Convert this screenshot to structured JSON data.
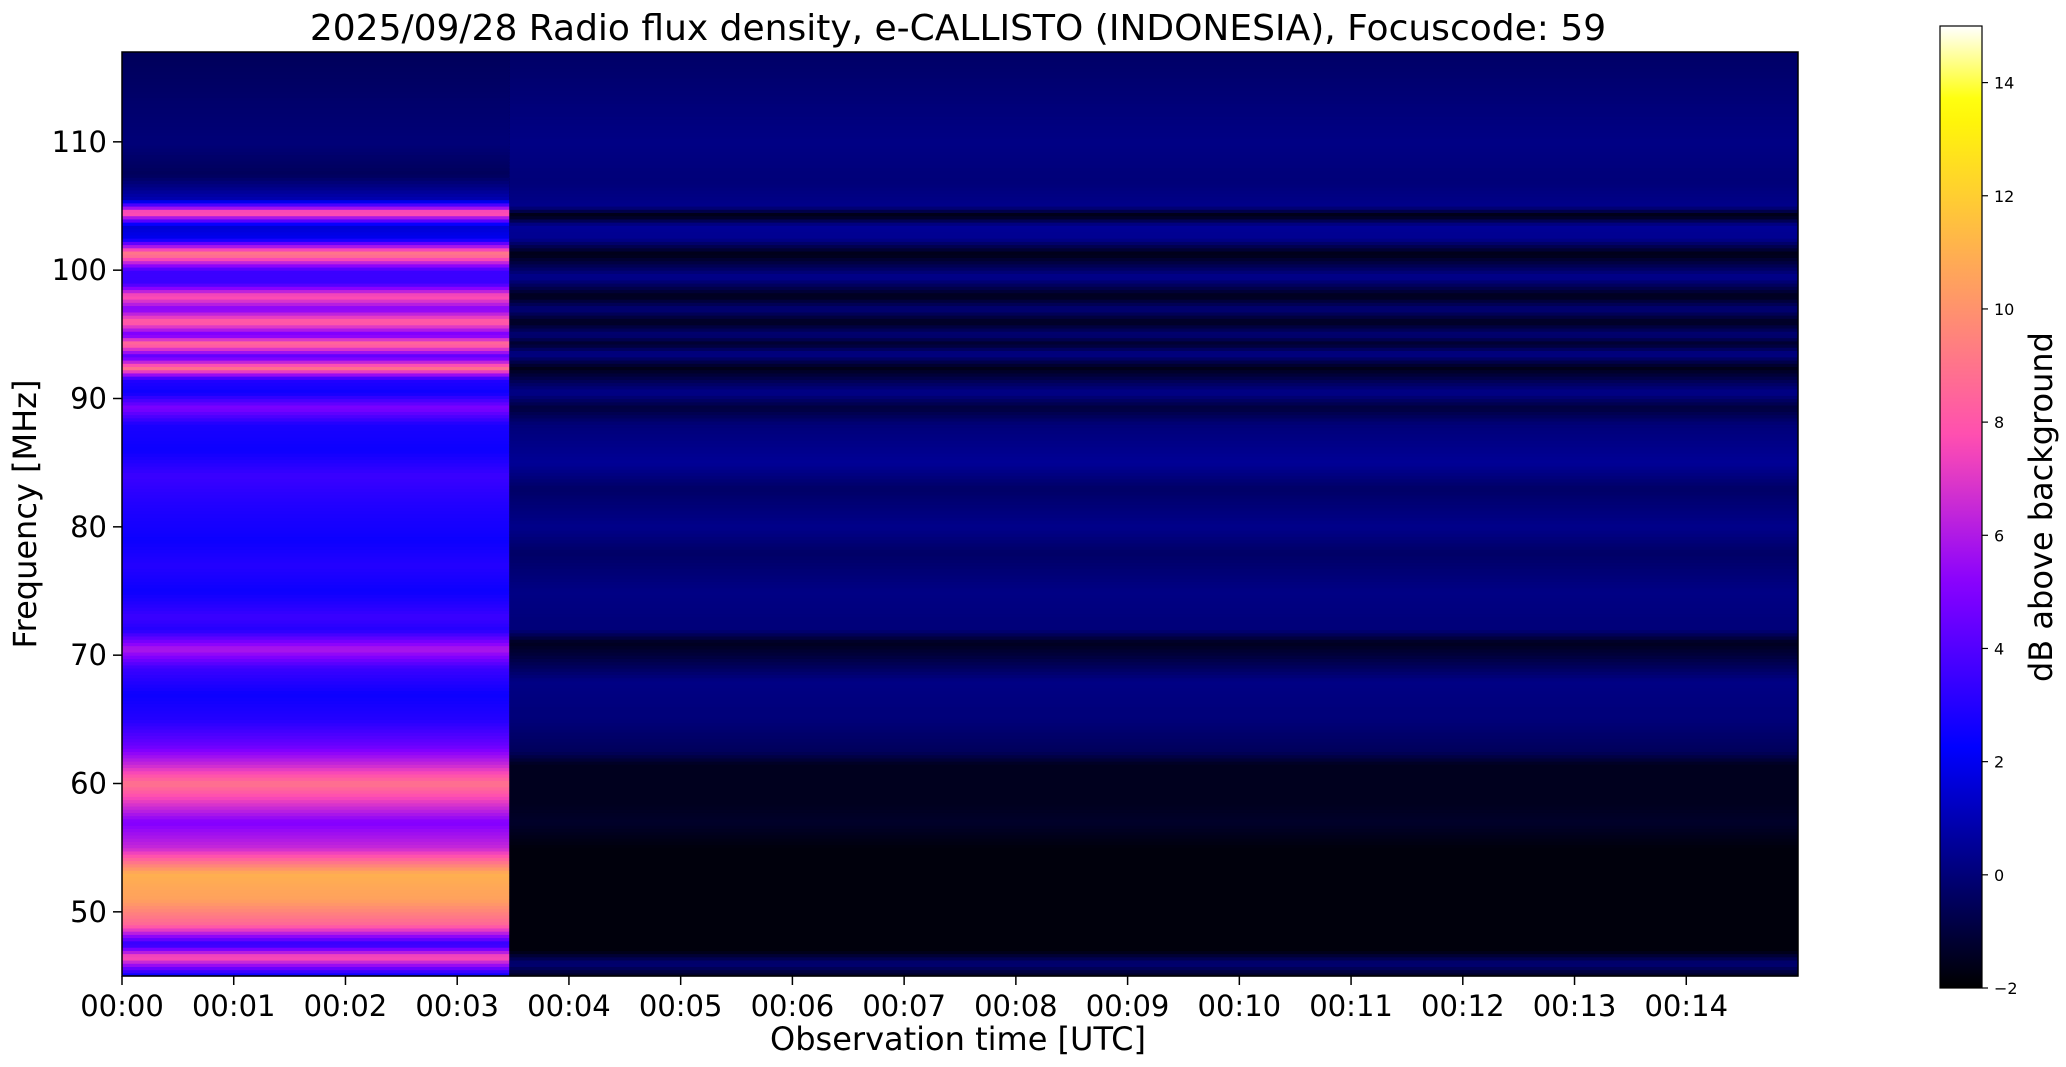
{
  "chart_data": {
    "type": "heatmap",
    "title": "2025/09/28  Radio flux density, e-CALLISTO (INDONESIA), Focuscode: 59",
    "xlabel": "Observation time [UTC]",
    "ylabel": "Frequency [MHz]",
    "xlim": [
      "00:00",
      "00:15"
    ],
    "ylim": [
      45,
      117
    ],
    "x_ticks": [
      "00:00",
      "00:01",
      "00:02",
      "00:03",
      "00:04",
      "00:05",
      "00:06",
      "00:07",
      "00:08",
      "00:09",
      "00:10",
      "00:11",
      "00:12",
      "00:13",
      "00:14"
    ],
    "y_ticks": [
      50,
      60,
      70,
      80,
      90,
      100,
      110
    ],
    "colorbar": {
      "label": "dB above background",
      "range": [
        -2,
        15
      ],
      "ticks": [
        -2,
        0,
        2,
        4,
        6,
        8,
        10,
        12,
        14
      ],
      "colormap": "gnuplot2"
    },
    "regime_change_time": "00:03:28",
    "active_segment": {
      "time_range": [
        "00:00",
        "00:03:28"
      ],
      "frequency_profile_db": [
        {
          "freq": 45.0,
          "db": 2.0
        },
        {
          "freq": 46.5,
          "db": 8.0
        },
        {
          "freq": 47.5,
          "db": 3.0
        },
        {
          "freq": 49.0,
          "db": 8.5
        },
        {
          "freq": 51.0,
          "db": 10.5
        },
        {
          "freq": 53.0,
          "db": 11.0
        },
        {
          "freq": 55.0,
          "db": 6.5
        },
        {
          "freq": 57.0,
          "db": 5.0
        },
        {
          "freq": 58.5,
          "db": 7.0
        },
        {
          "freq": 60.0,
          "db": 9.0
        },
        {
          "freq": 61.5,
          "db": 6.5
        },
        {
          "freq": 63.0,
          "db": 4.5
        },
        {
          "freq": 65.0,
          "db": 3.0
        },
        {
          "freq": 67.0,
          "db": 2.5
        },
        {
          "freq": 69.0,
          "db": 3.5
        },
        {
          "freq": 70.5,
          "db": 6.0
        },
        {
          "freq": 72.0,
          "db": 3.0
        },
        {
          "freq": 73.0,
          "db": 3.5
        },
        {
          "freq": 75.0,
          "db": 2.5
        },
        {
          "freq": 77.0,
          "db": 3.0
        },
        {
          "freq": 79.0,
          "db": 2.5
        },
        {
          "freq": 82.0,
          "db": 3.0
        },
        {
          "freq": 84.0,
          "db": 3.5
        },
        {
          "freq": 86.0,
          "db": 2.5
        },
        {
          "freq": 88.0,
          "db": 2.8
        },
        {
          "freq": 89.3,
          "db": 5.0
        },
        {
          "freq": 90.5,
          "db": 2.5
        },
        {
          "freq": 91.5,
          "db": 3.0
        },
        {
          "freq": 92.4,
          "db": 9.0
        },
        {
          "freq": 93.3,
          "db": 4.0
        },
        {
          "freq": 94.3,
          "db": 9.0
        },
        {
          "freq": 95.0,
          "db": 4.5
        },
        {
          "freq": 96.0,
          "db": 8.5
        },
        {
          "freq": 97.0,
          "db": 5.0
        },
        {
          "freq": 98.0,
          "db": 8.0
        },
        {
          "freq": 99.0,
          "db": 3.5
        },
        {
          "freq": 100.0,
          "db": 3.5
        },
        {
          "freq": 101.3,
          "db": 9.5
        },
        {
          "freq": 102.5,
          "db": 2.0
        },
        {
          "freq": 103.5,
          "db": 1.5
        },
        {
          "freq": 104.5,
          "db": 8.5
        },
        {
          "freq": 105.5,
          "db": 1.0
        },
        {
          "freq": 107.5,
          "db": -0.5
        },
        {
          "freq": 110.0,
          "db": 0.0
        },
        {
          "freq": 117.0,
          "db": -0.5
        }
      ]
    },
    "quiet_segment": {
      "time_range": [
        "00:03:28",
        "00:15"
      ],
      "frequency_profile_db": [
        {
          "freq": 45.0,
          "db": -1.5
        },
        {
          "freq": 46.0,
          "db": 0.0
        },
        {
          "freq": 47.0,
          "db": -1.8
        },
        {
          "freq": 55.0,
          "db": -1.8
        },
        {
          "freq": 57.0,
          "db": -1.3
        },
        {
          "freq": 58.5,
          "db": -1.5
        },
        {
          "freq": 61.5,
          "db": -1.5
        },
        {
          "freq": 62.5,
          "db": -0.5
        },
        {
          "freq": 65.0,
          "db": 0.0
        },
        {
          "freq": 68.0,
          "db": 0.2
        },
        {
          "freq": 70.0,
          "db": -1.0
        },
        {
          "freq": 71.0,
          "db": -1.5
        },
        {
          "freq": 72.0,
          "db": 0.0
        },
        {
          "freq": 75.0,
          "db": 0.2
        },
        {
          "freq": 78.0,
          "db": -0.3
        },
        {
          "freq": 80.0,
          "db": 0.3
        },
        {
          "freq": 83.0,
          "db": -0.3
        },
        {
          "freq": 85.0,
          "db": 0.5
        },
        {
          "freq": 88.0,
          "db": 0.0
        },
        {
          "freq": 89.3,
          "db": -1.0
        },
        {
          "freq": 90.5,
          "db": 0.3
        },
        {
          "freq": 92.4,
          "db": -1.6
        },
        {
          "freq": 93.5,
          "db": 0.3
        },
        {
          "freq": 94.3,
          "db": -1.3
        },
        {
          "freq": 95.0,
          "db": 0.0
        },
        {
          "freq": 96.0,
          "db": -1.5
        },
        {
          "freq": 97.0,
          "db": 0.0
        },
        {
          "freq": 98.0,
          "db": -1.6
        },
        {
          "freq": 99.5,
          "db": 0.4
        },
        {
          "freq": 101.3,
          "db": -1.7
        },
        {
          "freq": 102.5,
          "db": 0.4
        },
        {
          "freq": 103.5,
          "db": 0.5
        },
        {
          "freq": 104.3,
          "db": -1.8
        },
        {
          "freq": 105.0,
          "db": 0.3
        },
        {
          "freq": 107.0,
          "db": 0.0
        },
        {
          "freq": 110.0,
          "db": 0.2
        },
        {
          "freq": 113.0,
          "db": 0.0
        },
        {
          "freq": 117.0,
          "db": -0.3
        }
      ]
    }
  }
}
